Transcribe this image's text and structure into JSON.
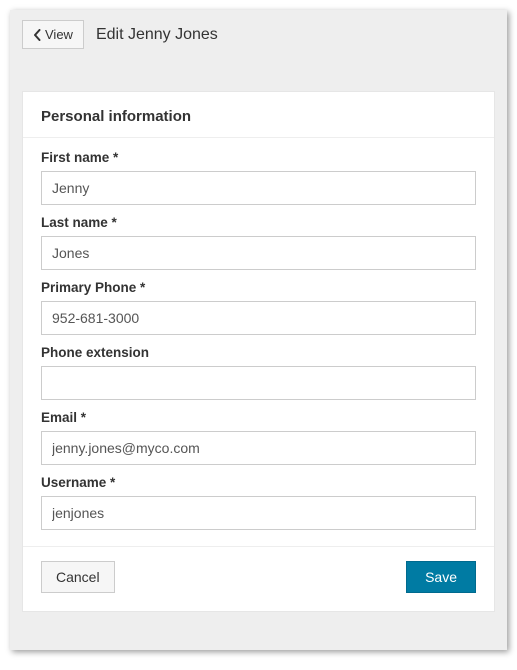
{
  "header": {
    "view_button": "View",
    "title": "Edit Jenny Jones"
  },
  "card": {
    "section_title": "Personal information",
    "fields": {
      "first_name": {
        "label": "First name *",
        "value": "Jenny"
      },
      "last_name": {
        "label": "Last name *",
        "value": "Jones"
      },
      "primary_phone": {
        "label": "Primary Phone *",
        "value": "952-681-3000"
      },
      "phone_ext": {
        "label": "Phone extension",
        "value": ""
      },
      "email": {
        "label": "Email *",
        "value": "jenny.jones@myco.com"
      },
      "username": {
        "label": "Username *",
        "value": "jenjones"
      }
    },
    "footer": {
      "cancel": "Cancel",
      "save": "Save"
    }
  }
}
